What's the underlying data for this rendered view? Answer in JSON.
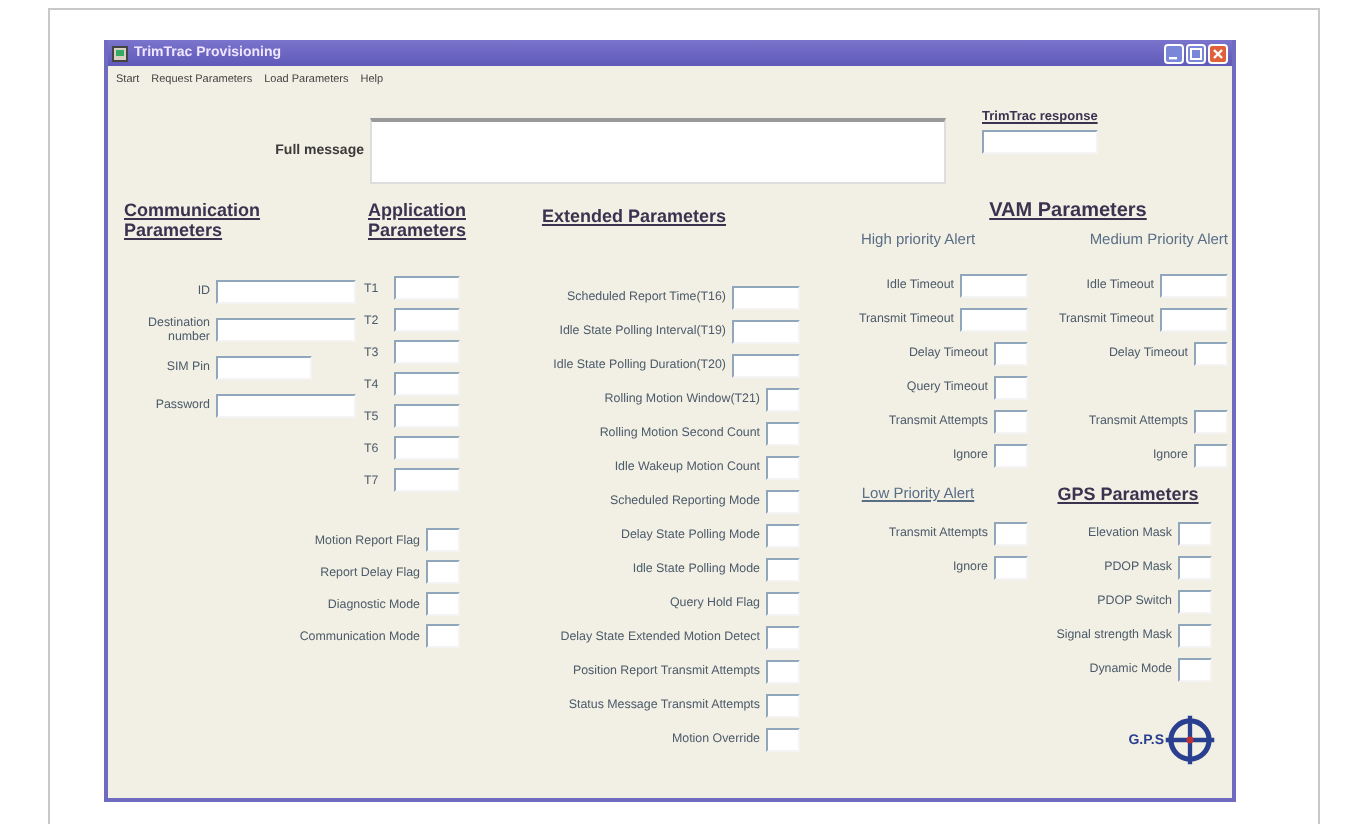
{
  "window": {
    "title": "TrimTrac Provisioning"
  },
  "menu": [
    "Start",
    "Request Parameters",
    "Load Parameters",
    "Help"
  ],
  "full_message": {
    "label": "Full message"
  },
  "response": {
    "label": "TrimTrac response"
  },
  "communication": {
    "title": "Communication Parameters",
    "fields": [
      {
        "label": "ID",
        "kind": "text"
      },
      {
        "label": "Destination number",
        "kind": "text"
      },
      {
        "label": "SIM Pin",
        "kind": "short"
      },
      {
        "label": "Password",
        "kind": "text"
      }
    ]
  },
  "application": {
    "title": "Application Parameters",
    "fields": [
      {
        "label": "T1"
      },
      {
        "label": "T2"
      },
      {
        "label": "T3"
      },
      {
        "label": "T4"
      },
      {
        "label": "T5"
      },
      {
        "label": "T6"
      },
      {
        "label": "T7"
      }
    ]
  },
  "flags": [
    {
      "label": "Motion Report Flag"
    },
    {
      "label": "Report Delay Flag"
    },
    {
      "label": "Diagnostic Mode"
    },
    {
      "label": "Communication Mode"
    }
  ],
  "extended": {
    "title": "Extended Parameters",
    "fields": [
      {
        "label": "Scheduled Report Time(T16)",
        "kind": "text"
      },
      {
        "label": "Idle State Polling Interval(T19)",
        "kind": "text"
      },
      {
        "label": "Idle State Polling Duration(T20)",
        "kind": "text"
      },
      {
        "label": "Rolling Motion Window(T21)",
        "kind": "box"
      },
      {
        "label": "Rolling Motion Second Count",
        "kind": "box"
      },
      {
        "label": "Idle Wakeup Motion Count",
        "kind": "box"
      },
      {
        "label": "Scheduled Reporting Mode",
        "kind": "box"
      },
      {
        "label": "Delay State Polling Mode",
        "kind": "box"
      },
      {
        "label": "Idle State Polling Mode",
        "kind": "box"
      },
      {
        "label": "Query Hold Flag",
        "kind": "box"
      },
      {
        "label": "Delay State Extended Motion Detect",
        "kind": "box"
      },
      {
        "label": "Position Report Transmit Attempts",
        "kind": "box"
      },
      {
        "label": "Status Message Transmit Attempts",
        "kind": "box"
      },
      {
        "label": "Motion Override",
        "kind": "box"
      }
    ]
  },
  "vam": {
    "title": "VAM Parameters",
    "high_title": "High priority Alert",
    "medium_title": "Medium Priority Alert",
    "rows": [
      {
        "high": {
          "label": "Idle Timeout",
          "kind": "text"
        },
        "medium": {
          "label": "Idle Timeout",
          "kind": "text"
        }
      },
      {
        "high": {
          "label": "Transmit Timeout",
          "kind": "text"
        },
        "medium": {
          "label": "Transmit Timeout",
          "kind": "text"
        }
      },
      {
        "high": {
          "label": "Delay Timeout",
          "kind": "box"
        },
        "medium": {
          "label": "Delay Timeout",
          "kind": "box"
        }
      },
      {
        "high": {
          "label": "Query Timeout",
          "kind": "box"
        }
      },
      {
        "high": {
          "label": "Transmit Attempts",
          "kind": "box"
        },
        "medium": {
          "label": "Transmit Attempts",
          "kind": "box"
        }
      },
      {
        "high": {
          "label": "Ignore",
          "kind": "box"
        },
        "medium": {
          "label": "Ignore",
          "kind": "box"
        }
      }
    ]
  },
  "low_priority": {
    "title": "Low Priority Alert",
    "fields": [
      {
        "label": "Transmit Attempts",
        "kind": "box"
      },
      {
        "label": "Ignore",
        "kind": "box"
      }
    ]
  },
  "gps": {
    "title": "GPS Parameters",
    "fields": [
      {
        "label": "Elevation Mask",
        "kind": "box"
      },
      {
        "label": "PDOP Mask",
        "kind": "box"
      },
      {
        "label": "PDOP Switch",
        "kind": "box"
      },
      {
        "label": "Signal strength Mask",
        "kind": "box"
      },
      {
        "label": "Dynamic Mode",
        "kind": "box"
      }
    ]
  },
  "logo": {
    "text": "G.P.S"
  }
}
